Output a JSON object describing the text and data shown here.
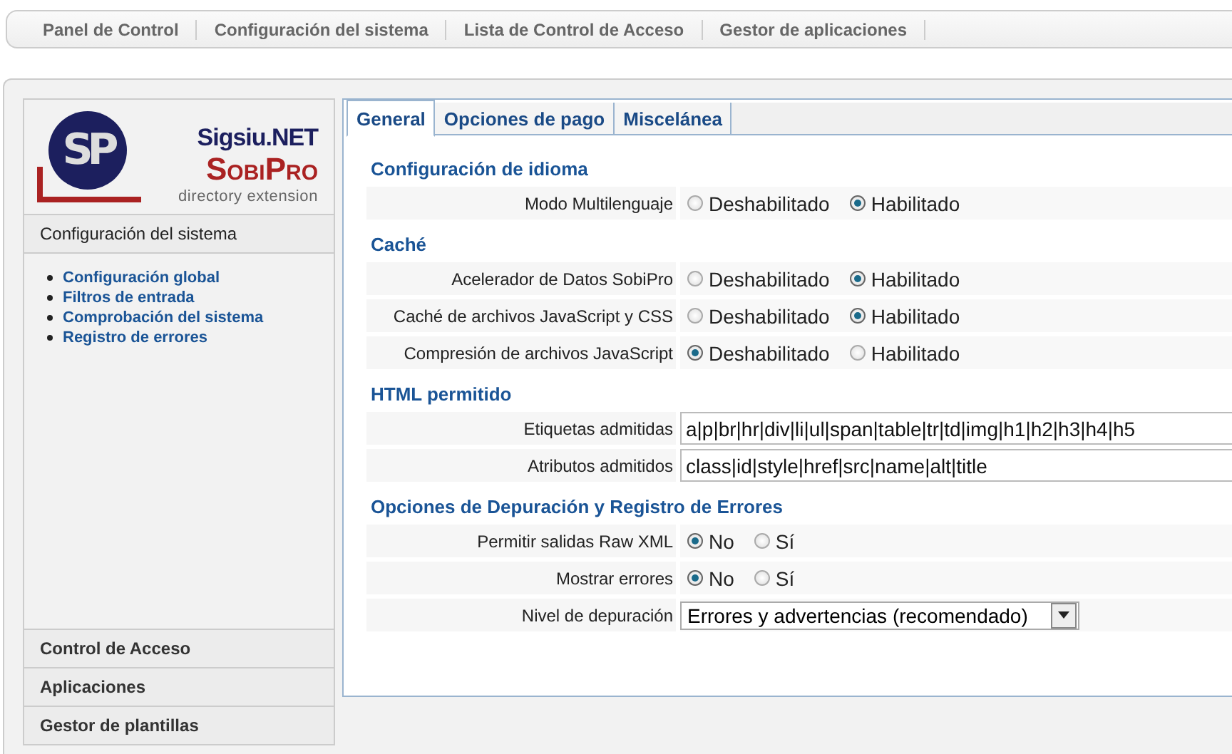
{
  "top_nav": [
    {
      "label": "Panel de Control"
    },
    {
      "label": "Configuración del sistema"
    },
    {
      "label": "Lista de Control de Acceso"
    },
    {
      "label": "Gestor de aplicaciones"
    }
  ],
  "sidebar": {
    "logo": {
      "mark": "SP",
      "company": "Sigsiu.NET",
      "product": "SobiPro",
      "tagline": "directory extension"
    },
    "section": "Configuración del sistema",
    "links": [
      {
        "label": "Configuración global"
      },
      {
        "label": "Filtros de entrada"
      },
      {
        "label": "Comprobación del sistema"
      },
      {
        "label": "Registro de errores"
      }
    ],
    "bottom_items": [
      {
        "label": "Control de Acceso"
      },
      {
        "label": "Aplicaciones"
      },
      {
        "label": "Gestor de plantillas"
      }
    ]
  },
  "tabs": [
    {
      "label": "General",
      "selected": true
    },
    {
      "label": "Opciones de pago",
      "selected": false
    },
    {
      "label": "Miscelánea",
      "selected": false
    }
  ],
  "sections": [
    {
      "title": "Configuración de idioma",
      "rows": [
        {
          "kind": "radio",
          "label": "Modo Multilenguaje",
          "options": [
            {
              "label": "Deshabilitado",
              "selected": false
            },
            {
              "label": "Habilitado",
              "selected": true
            }
          ]
        }
      ]
    },
    {
      "title": "Caché",
      "rows": [
        {
          "kind": "radio",
          "label": "Acelerador de Datos SobiPro",
          "options": [
            {
              "label": "Deshabilitado",
              "selected": false
            },
            {
              "label": "Habilitado",
              "selected": true
            }
          ]
        },
        {
          "kind": "radio",
          "label": "Caché de archivos JavaScript y CSS",
          "options": [
            {
              "label": "Deshabilitado",
              "selected": false
            },
            {
              "label": "Habilitado",
              "selected": true
            }
          ]
        },
        {
          "kind": "radio",
          "label": "Compresión de archivos JavaScript",
          "options": [
            {
              "label": "Deshabilitado",
              "selected": true
            },
            {
              "label": "Habilitado",
              "selected": false
            }
          ]
        }
      ]
    },
    {
      "title": "HTML permitido",
      "rows": [
        {
          "kind": "text",
          "label": "Etiquetas admitidas",
          "value": "a|p|br|hr|div|li|ul|span|table|tr|td|img|h1|h2|h3|h4|h5"
        },
        {
          "kind": "text",
          "label": "Atributos admitidos",
          "value": "class|id|style|href|src|name|alt|title"
        }
      ]
    },
    {
      "title": "Opciones de Depuración y Registro de Errores",
      "rows": [
        {
          "kind": "radio",
          "label": "Permitir salidas Raw XML",
          "options": [
            {
              "label": "No",
              "selected": true
            },
            {
              "label": "Sí",
              "selected": false
            }
          ]
        },
        {
          "kind": "radio",
          "label": "Mostrar errores",
          "options": [
            {
              "label": "No",
              "selected": true
            },
            {
              "label": "Sí",
              "selected": false
            }
          ]
        },
        {
          "kind": "select",
          "label": "Nivel de depuración",
          "value": "Errores y advertencias (recomendado)"
        }
      ]
    }
  ]
}
